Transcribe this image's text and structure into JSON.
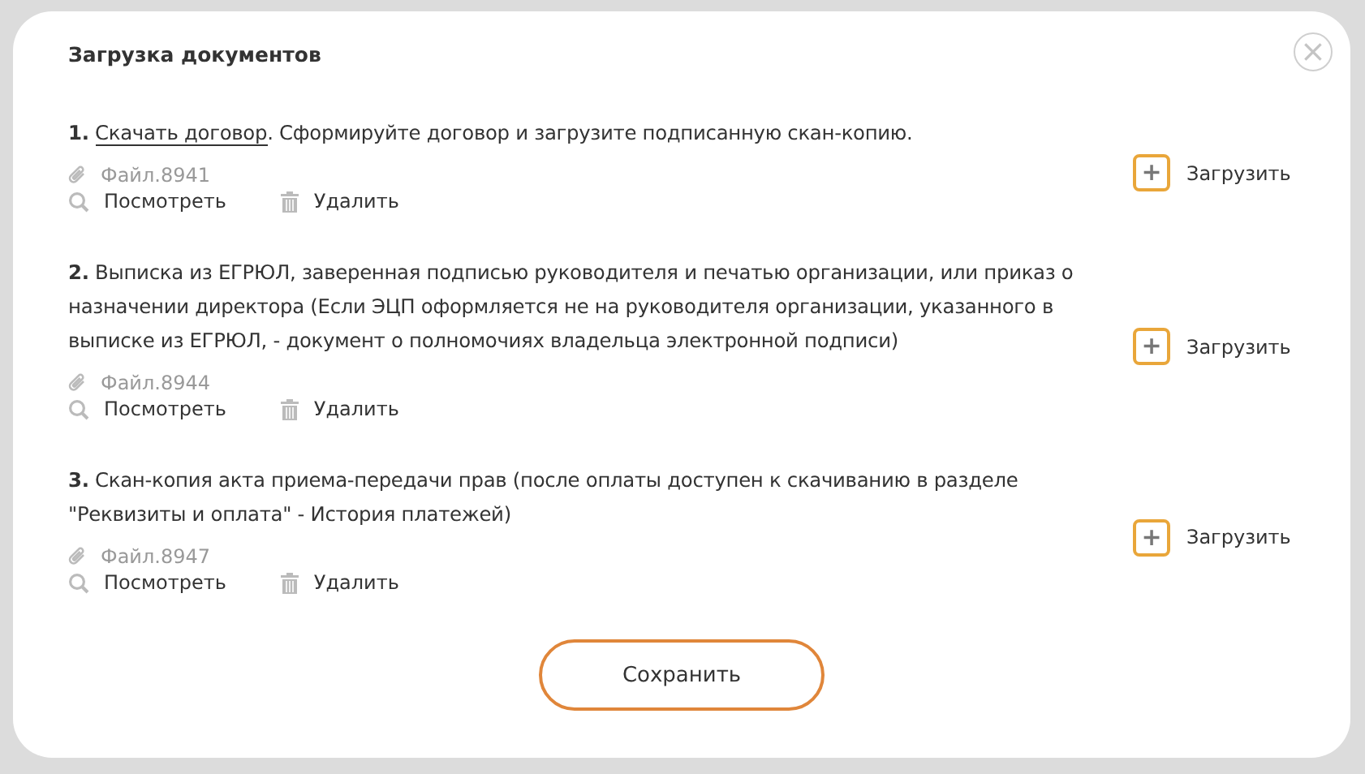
{
  "dialog": {
    "title": "Загрузка документов",
    "close_label": "×"
  },
  "documents": [
    {
      "number": "1.",
      "link": "Скачать договор",
      "text": ". Сформируйте договор и загрузите подписанную скан-копию.",
      "file": "Файл.8941",
      "view": "Посмотреть",
      "delete": "Удалить",
      "upload": "Загрузить",
      "upload_icon": "+"
    },
    {
      "number": "2.",
      "text": "Выписка из ЕГРЮЛ, заверенная подписью руководителя и печатью организации, или приказ о назначении директора (Если ЭЦП оформляется не на руководителя организации, указанного в выписке из ЕГРЮЛ, - документ о полномочиях владельца электронной подписи)",
      "file": "Файл.8944",
      "view": "Посмотреть",
      "delete": "Удалить",
      "upload": "Загрузить",
      "upload_icon": "+"
    },
    {
      "number": "3.",
      "text": "Скан-копия акта приема-передачи прав (после оплаты доступен к скачиванию в разделе \"Реквизиты и оплата\" - История платежей)",
      "file": "Файл.8947",
      "view": "Посмотреть",
      "delete": "Удалить",
      "upload": "Загрузить",
      "upload_icon": "+"
    }
  ],
  "save_button": "Сохранить"
}
